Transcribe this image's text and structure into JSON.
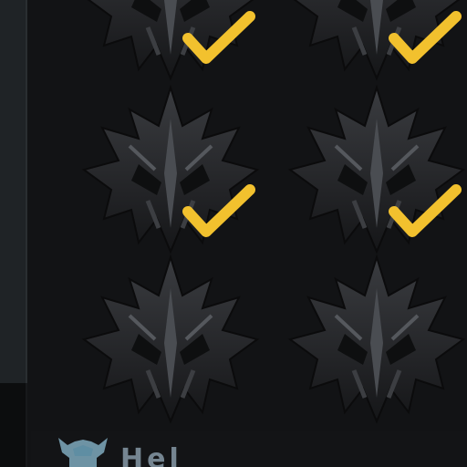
{
  "grid": {
    "items": [
      {
        "icon": "mask-helmet-icon",
        "checked": true
      },
      {
        "icon": "mask-helmet-icon",
        "checked": true
      },
      {
        "icon": "mask-helmet-icon",
        "checked": true
      },
      {
        "icon": "mask-helmet-icon",
        "checked": true
      },
      {
        "icon": "mask-helmet-icon",
        "checked": false
      },
      {
        "icon": "mask-helmet-icon",
        "checked": false
      }
    ]
  },
  "bottom": {
    "icon": "horned-helmet-icon",
    "label": "Hel"
  },
  "colors": {
    "background": "#121315",
    "check": "#f2c12e",
    "mask": "#2b2d30",
    "bottom_icon": "#7fa9bd"
  }
}
